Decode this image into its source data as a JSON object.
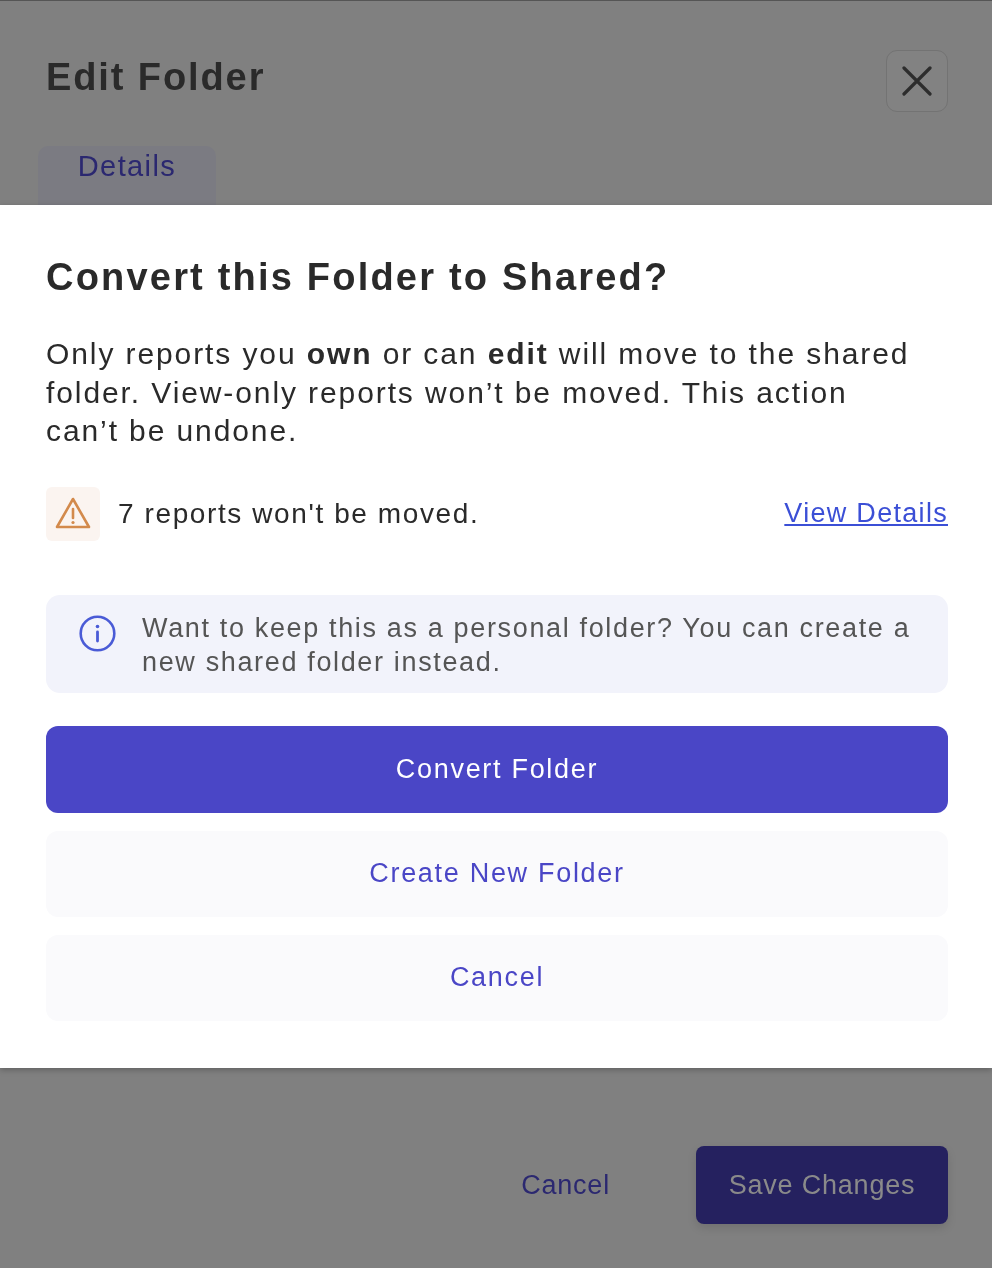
{
  "background_dialog": {
    "title": "Edit Folder",
    "tabs": [
      {
        "label": "Details",
        "selected": true
      }
    ],
    "footer_buttons": [
      {
        "label": "Cancel",
        "kind": "text"
      },
      {
        "label": "Save Changes",
        "kind": "primary"
      }
    ]
  },
  "confirm_dialog": {
    "title": "Convert this Folder to Shared?",
    "message": "Only reports you **own** or can **edit** will move to the shared folder. View-only reports won’t be moved. This action can’t be undone.",
    "warning": {
      "text": "7 reports won't be moved.",
      "link": "View Details"
    },
    "info": {
      "text": "Want to keep this as a personal folder? You can create a new shared folder instead."
    },
    "buttons": [
      {
        "label": "Convert Folder",
        "kind": "primary"
      },
      {
        "label": "Create New Folder",
        "kind": "secondary"
      },
      {
        "label": "Cancel",
        "kind": "secondary"
      }
    ]
  }
}
